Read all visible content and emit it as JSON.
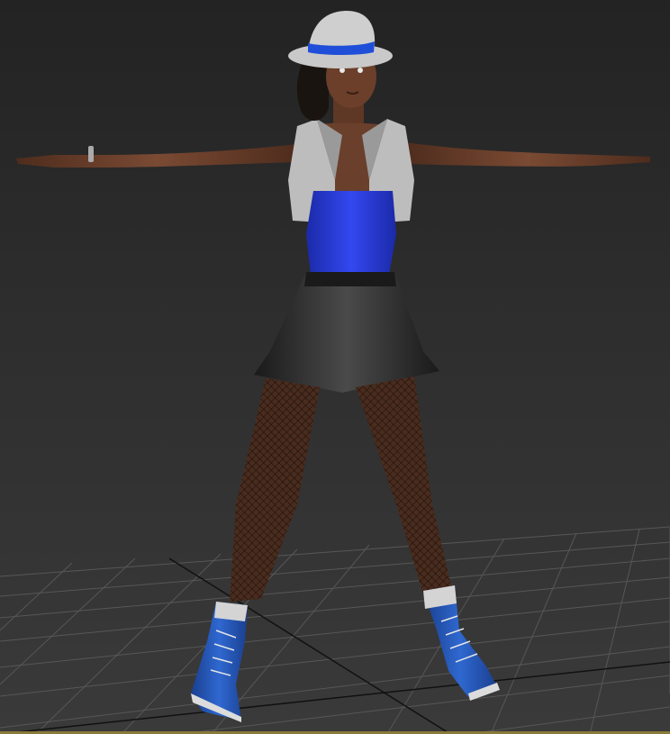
{
  "viewport": {
    "type": "3d-perspective-viewport",
    "background_color": "#2e2e2e",
    "grid_color": "#5a5a5a",
    "grid_axis_color": "#111111",
    "bottom_border_color": "#8a7a3a"
  },
  "model": {
    "pose": "T-pose",
    "description_icon": "female-character-model",
    "palette": {
      "skin": "#6b3f2a",
      "hat": "#c9c9c9",
      "hat_band": "#1f4fd8",
      "vest": "#bdbdbd",
      "top": "#2a3fe0",
      "skirt": "#2a2a2a",
      "stockings": "#3a2418",
      "shoes": "#2656b8",
      "shoe_trim": "#d8d8d8",
      "hair": "#1a1410"
    }
  }
}
